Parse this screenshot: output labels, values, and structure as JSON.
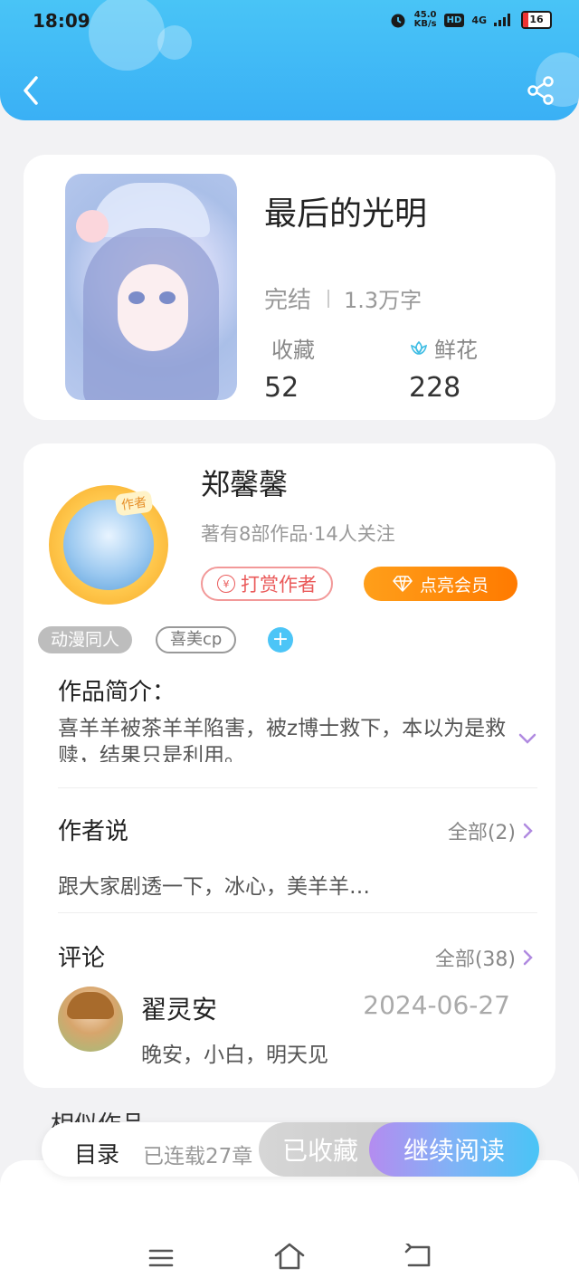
{
  "status_bar": {
    "time": "18:09",
    "net_speed_value": "45.0",
    "net_speed_unit": "KB/s",
    "hd_label": "HD",
    "signal_label": "4G",
    "battery": "16"
  },
  "book": {
    "title": "最后的光明",
    "status": "完结",
    "word_count": "1.3万字",
    "favorites_label": "收藏",
    "favorites_value": "52",
    "flowers_label": "鲜花",
    "flowers_value": "228"
  },
  "author": {
    "badge": "作者",
    "name": "郑馨馨",
    "info": "著有8部作品·14人关注",
    "tip_button": "打赏作者",
    "tip_symbol": "¥",
    "vip_button": "点亮会员",
    "tags": [
      "动漫同人",
      "喜美cp"
    ],
    "add_tag": "+"
  },
  "intro": {
    "title": "作品简介：",
    "text": "喜羊羊被茶羊羊陷害，被z博士救下，本以为是救赎，结果只是利用。"
  },
  "author_says": {
    "title": "作者说",
    "more": "全部(2)",
    "text": "跟大家剧透一下，冰心，美羊羊…"
  },
  "comments": {
    "title": "评论",
    "more": "全部(38)",
    "items": [
      {
        "user": "翟灵安",
        "date": "2024-06-27",
        "text": "晚安，小白，明天见"
      }
    ]
  },
  "similar": {
    "title": "相似作品"
  },
  "bottom_bar": {
    "toc": "目录",
    "serial": "已连载27章",
    "favorited": "已收藏",
    "continue": "继续阅读"
  },
  "colors": {
    "header": "#49c4f6",
    "vip": "#ff8a00",
    "tip": "#ea5a5a",
    "read_gradient_start": "#b48cf0"
  }
}
